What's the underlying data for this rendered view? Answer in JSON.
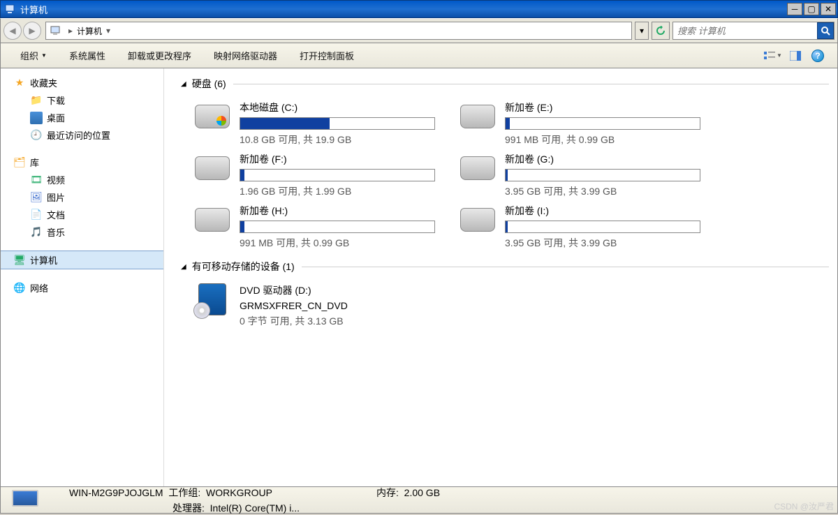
{
  "window": {
    "title": "计算机"
  },
  "breadcrumb": {
    "root_sep": "▸",
    "current": "计算机",
    "drop": "▾"
  },
  "search": {
    "placeholder": "搜索 计算机"
  },
  "toolbar": {
    "organize": "组织",
    "sys_props": "系统属性",
    "uninstall": "卸载或更改程序",
    "map_drive": "映射网络驱动器",
    "control_panel": "打开控制面板"
  },
  "sidebar": {
    "favorites": "收藏夹",
    "downloads": "下载",
    "desktop": "桌面",
    "recent": "最近访问的位置",
    "libraries": "库",
    "videos": "视频",
    "pictures": "图片",
    "documents": "文档",
    "music": "音乐",
    "computer": "计算机",
    "network": "网络"
  },
  "sections": {
    "hdd": "硬盘 (6)",
    "removable": "有可移动存储的设备 (1)"
  },
  "drives": [
    {
      "name": "本地磁盘 (C:)",
      "stat": "10.8 GB 可用, 共 19.9 GB",
      "pct": 46,
      "sys": true
    },
    {
      "name": "新加卷 (E:)",
      "stat": "991 MB 可用, 共 0.99 GB",
      "pct": 2
    },
    {
      "name": "新加卷 (F:)",
      "stat": "1.96 GB 可用, 共 1.99 GB",
      "pct": 2
    },
    {
      "name": "新加卷 (G:)",
      "stat": "3.95 GB 可用, 共 3.99 GB",
      "pct": 1
    },
    {
      "name": "新加卷 (H:)",
      "stat": "991 MB 可用, 共 0.99 GB",
      "pct": 2
    },
    {
      "name": "新加卷 (I:)",
      "stat": "3.95 GB 可用, 共 3.99 GB",
      "pct": 1
    }
  ],
  "removable": [
    {
      "name": "DVD 驱动器 (D:)",
      "label": "GRMSXFRER_CN_DVD",
      "stat": "0 字节 可用, 共 3.13 GB"
    }
  ],
  "status": {
    "hostname": "WIN-M2G9PJOJGLM",
    "workgroup_label": "工作组:",
    "workgroup": "WORKGROUP",
    "memory_label": "内存:",
    "memory": "2.00 GB",
    "cpu_label": "处理器:",
    "cpu": "Intel(R) Core(TM) i..."
  },
  "watermark": "CSDN @汝严君"
}
